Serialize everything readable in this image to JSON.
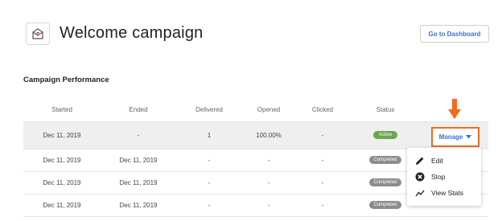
{
  "header": {
    "title": "Welcome campaign",
    "dashboard_button": "Go to Dashboard"
  },
  "section": {
    "title": "Campaign Performance"
  },
  "table": {
    "columns": [
      "Started",
      "Ended",
      "Delivered",
      "Opened",
      "Clicked",
      "Status"
    ],
    "rows": [
      {
        "started": "Dec 11, 2019",
        "ended": "-",
        "delivered": "1",
        "opened": "100.00%",
        "clicked": "-",
        "status": "Active"
      },
      {
        "started": "Dec 11, 2019",
        "ended": "Dec 11, 2019",
        "delivered": "-",
        "opened": "-",
        "clicked": "-",
        "status": "Completed"
      },
      {
        "started": "Dec 11, 2019",
        "ended": "Dec 11, 2019",
        "delivered": "-",
        "opened": "-",
        "clicked": "-",
        "status": "Completed"
      },
      {
        "started": "Dec 11, 2019",
        "ended": "Dec 11, 2019",
        "delivered": "-",
        "opened": "-",
        "clicked": "-",
        "status": "Completed"
      }
    ]
  },
  "manage": {
    "label": "Manage"
  },
  "menu": {
    "items": [
      {
        "label": "Edit",
        "icon": "pencil-icon"
      },
      {
        "label": "Stop",
        "icon": "stop-circle-icon"
      },
      {
        "label": "View Stats",
        "icon": "trend-line-icon"
      }
    ]
  },
  "colors": {
    "accent": "#3b6fd4",
    "highlight": "#f26b1d",
    "active": "#6aa84f",
    "completed": "#8c8c8c"
  }
}
